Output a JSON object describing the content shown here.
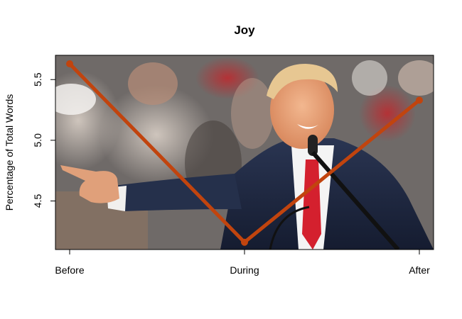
{
  "chart_data": {
    "type": "line",
    "title": "Joy",
    "xlabel": "",
    "ylabel": "Percentage of Total Words",
    "categories": [
      "Before",
      "During",
      "After"
    ],
    "series": [
      {
        "values": [
          5.63,
          4.16,
          5.33
        ],
        "color": "#c1440e"
      }
    ],
    "ylim": [
      4.1,
      5.7
    ],
    "yticks": [
      4.5,
      5.0,
      5.5
    ],
    "ytick_labels": [
      "4.5",
      "5.0",
      "5.5"
    ],
    "grid": false,
    "background": "photograph of a man in a dark suit and red tie smiling and pointing at a microphone in front of a crowd"
  }
}
